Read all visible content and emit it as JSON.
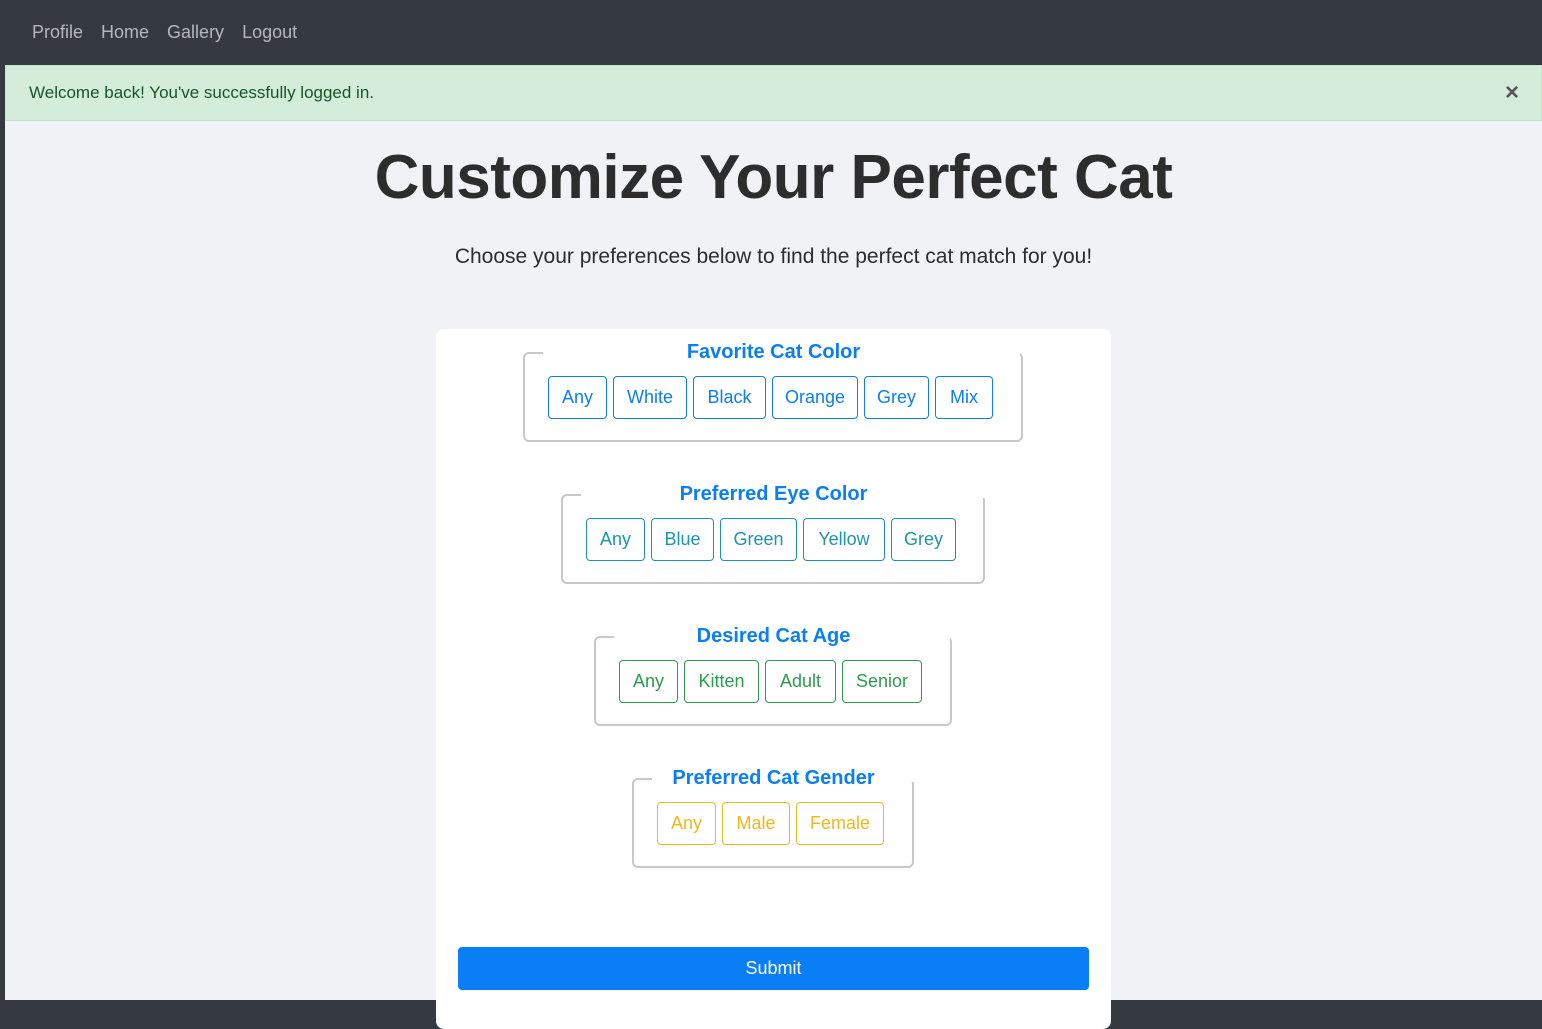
{
  "nav": {
    "links": [
      "Profile",
      "Home",
      "Gallery",
      "Logout"
    ]
  },
  "alert": {
    "message": "Welcome back! You've successfully logged in.",
    "close": "×"
  },
  "header": {
    "title": "Customize Your Perfect Cat",
    "subtitle": "Choose your preferences below to find the perfect cat match for you!"
  },
  "groups": [
    {
      "legend": "Favorite Cat Color",
      "options": [
        "Any",
        "White",
        "Black",
        "Orange",
        "Grey",
        "Mix"
      ],
      "color": "#0a7ef5"
    },
    {
      "legend": "Preferred Eye Color",
      "options": [
        "Any",
        "Blue",
        "Green",
        "Yellow",
        "Grey"
      ],
      "color": "#1c95ab"
    },
    {
      "legend": "Desired Cat Age",
      "options": [
        "Any",
        "Kitten",
        "Adult",
        "Senior"
      ],
      "color": "#2c9c4a"
    },
    {
      "legend": "Preferred Cat Gender",
      "options": [
        "Any",
        "Male",
        "Female"
      ],
      "color": "#f0b71a"
    }
  ],
  "form": {
    "submit_label": "Submit"
  },
  "colors": {
    "navbar": "#343a40",
    "primary": "#0a7ef5",
    "alert_bg": "#d4edda"
  }
}
